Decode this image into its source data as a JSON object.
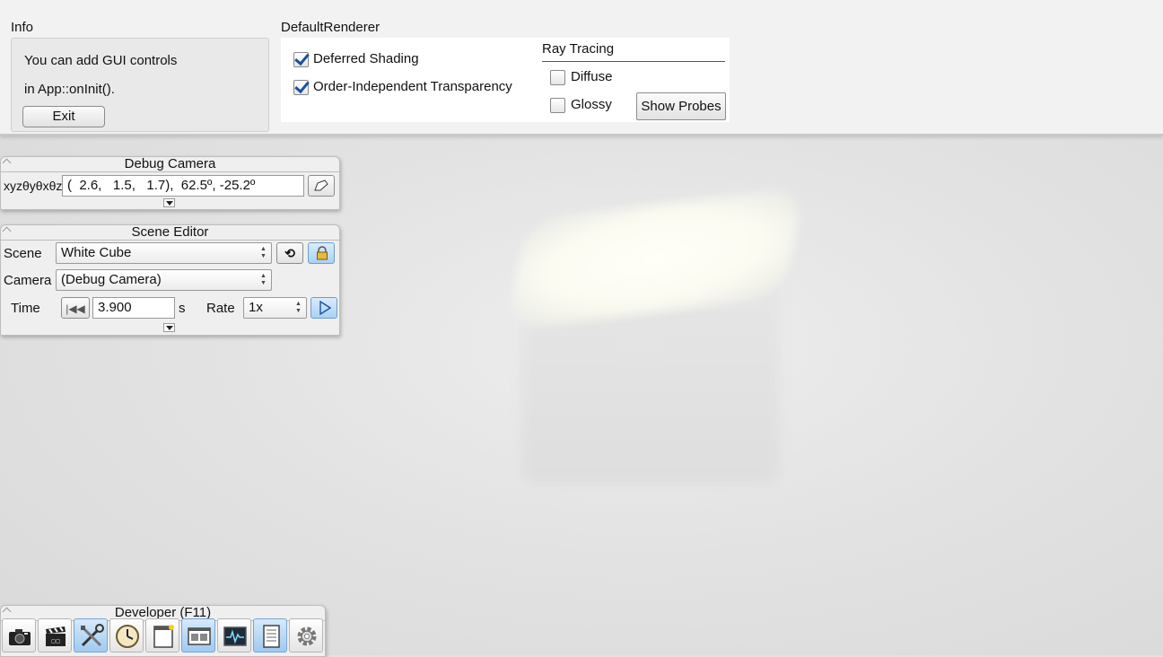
{
  "info": {
    "title": "Info",
    "line1": "You can add GUI controls",
    "line2": "in App::onInit().",
    "exit_label": "Exit"
  },
  "renderer": {
    "title": "DefaultRenderer",
    "deferred_shading": {
      "label": "Deferred Shading",
      "checked": true
    },
    "oit": {
      "label": "Order-Independent Transparency",
      "checked": true
    },
    "ray_tracing": {
      "title": "Ray Tracing",
      "diffuse": {
        "label": "Diffuse",
        "checked": false
      },
      "glossy": {
        "label": "Glossy",
        "checked": false
      },
      "show_probes_label": "Show Probes"
    }
  },
  "debug_camera": {
    "title": "Debug Camera",
    "coord_label": "xyzθyθxθz",
    "coord_value": "(  2.6,   1.5,   1.7),  62.5º, -25.2º"
  },
  "scene_editor": {
    "title": "Scene Editor",
    "scene_label": "Scene",
    "scene_value": "White Cube",
    "camera_label": "Camera",
    "camera_value": "(Debug Camera)",
    "time_label": "Time",
    "time_value": "3.900",
    "time_unit": "s",
    "rate_label": "Rate",
    "rate_value": "1x"
  },
  "developer": {
    "title": "Developer (F11)",
    "tools": [
      "camera-icon",
      "clapperboard-icon",
      "tools-icon",
      "clock-icon",
      "window-icon",
      "scene-icon",
      "profiler-icon",
      "log-icon",
      "gear-icon"
    ],
    "selected": [
      "tools-icon",
      "scene-icon",
      "log-icon"
    ]
  },
  "colors": {
    "checkmark": "#1b4fa0",
    "selected_button": "#a9d1f4"
  }
}
